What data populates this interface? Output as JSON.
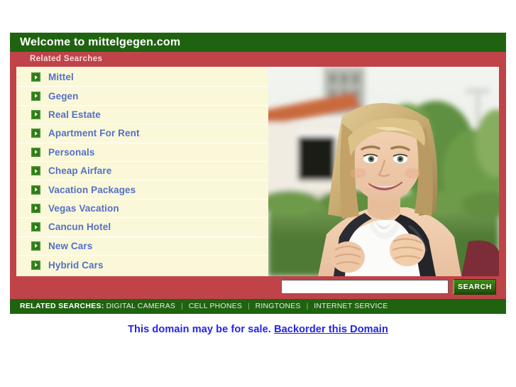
{
  "header": {
    "title": "Welcome to mittelgegen.com",
    "title_bg": "#1f6310"
  },
  "related_searches_bar": {
    "label": "Related Searches",
    "bg": "#c0434a"
  },
  "sidebar": {
    "items": [
      {
        "label": "Mittel",
        "icon": "chevron-right-icon"
      },
      {
        "label": "Gegen",
        "icon": "chevron-right-icon"
      },
      {
        "label": "Real Estate",
        "icon": "chevron-right-icon"
      },
      {
        "label": "Apartment For Rent",
        "icon": "chevron-right-icon"
      },
      {
        "label": "Personals",
        "icon": "chevron-right-icon"
      },
      {
        "label": "Cheap Airfare",
        "icon": "chevron-right-icon"
      },
      {
        "label": "Vacation Packages",
        "icon": "chevron-right-icon"
      },
      {
        "label": "Vegas Vacation",
        "icon": "chevron-right-icon"
      },
      {
        "label": "Cancun Hotel",
        "icon": "chevron-right-icon"
      },
      {
        "label": "New Cars",
        "icon": "chevron-right-icon"
      },
      {
        "label": "Hybrid Cars",
        "icon": "chevron-right-icon"
      }
    ],
    "link_color": "#5470c6",
    "bg": "#faf8d8"
  },
  "photo": {
    "alt": "Smiling blonde young woman wearing a backpack outdoors in front of a building with trees"
  },
  "search": {
    "value": "",
    "placeholder": "",
    "button_label": "SEARCH"
  },
  "footer": {
    "label": "RELATED SEARCHES:",
    "links": [
      "DIGITAL CAMERAS",
      "CELL PHONES",
      "RINGTONES",
      "INTERNET SERVICE"
    ],
    "bg": "#1f6310"
  },
  "sale_notice": {
    "text": "This domain may be for sale.",
    "link_text": "Backorder this Domain",
    "color": "#2222ee"
  }
}
